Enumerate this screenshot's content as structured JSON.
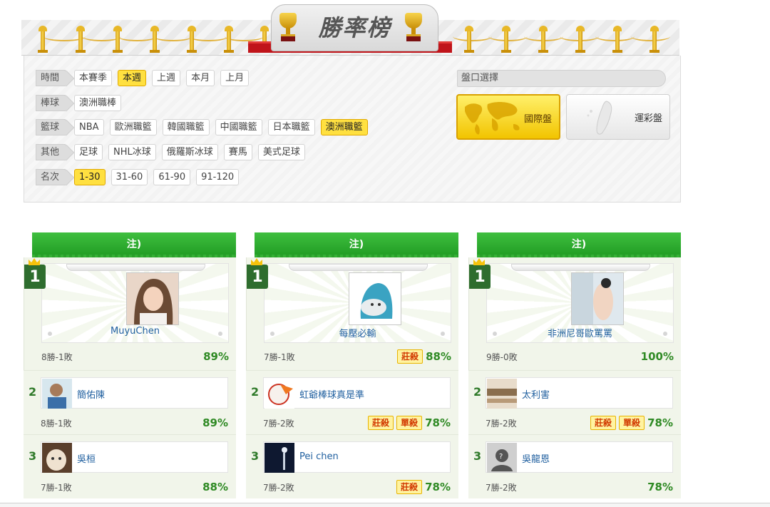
{
  "banner": {
    "title": "勝率榜"
  },
  "filters": {
    "rows": [
      {
        "label": "時間",
        "options": [
          {
            "text": "本賽季",
            "active": false
          },
          {
            "text": "本週",
            "active": true
          },
          {
            "text": "上週",
            "active": false
          },
          {
            "text": "本月",
            "active": false
          },
          {
            "text": "上月",
            "active": false
          }
        ]
      },
      {
        "label": "棒球",
        "options": [
          {
            "text": "澳洲職棒",
            "active": false
          }
        ]
      },
      {
        "label": "籃球",
        "options": [
          {
            "text": "NBA",
            "active": false
          },
          {
            "text": "歐洲職籃",
            "active": false
          },
          {
            "text": "韓國職籃",
            "active": false
          },
          {
            "text": "中國職籃",
            "active": false
          },
          {
            "text": "日本職籃",
            "active": false
          },
          {
            "text": "澳洲職籃",
            "active": true
          }
        ]
      },
      {
        "label": "其他",
        "options": [
          {
            "text": "足球",
            "active": false
          },
          {
            "text": "NHL冰球",
            "active": false
          },
          {
            "text": "俄羅斯冰球",
            "active": false
          },
          {
            "text": "賽馬",
            "active": false
          },
          {
            "text": "美式足球",
            "active": false
          }
        ]
      },
      {
        "label": "名次",
        "options": [
          {
            "text": "1-30",
            "active": true
          },
          {
            "text": "31-60",
            "active": false
          },
          {
            "text": "61-90",
            "active": false
          },
          {
            "text": "91-120",
            "active": false
          }
        ]
      }
    ]
  },
  "market": {
    "header": "盤口選擇",
    "international": "國際盤",
    "lottery": "運彩盤"
  },
  "columns": [
    {
      "header": "注)",
      "first": {
        "rank": "1",
        "name": "MuyuChen",
        "record": "8勝-1敗",
        "pct": "89%",
        "badges": []
      },
      "rows": [
        {
          "rank": "2",
          "name": "簡佑陳",
          "record": "8勝-1敗",
          "pct": "89%",
          "badges": []
        },
        {
          "rank": "3",
          "name": "吳桓",
          "record": "7勝-1敗",
          "pct": "88%",
          "badges": []
        }
      ]
    },
    {
      "header": "注)",
      "first": {
        "rank": "1",
        "name": "每壓必輸",
        "record": "7勝-1敗",
        "pct": "88%",
        "badges": [
          "莊殺"
        ]
      },
      "rows": [
        {
          "rank": "2",
          "name": "虹爺棒球真是準",
          "record": "7勝-2敗",
          "pct": "78%",
          "badges": [
            "莊殺",
            "單殺"
          ]
        },
        {
          "rank": "3",
          "name": "Pei chen",
          "record": "7勝-2敗",
          "pct": "78%",
          "badges": [
            "莊殺"
          ]
        }
      ]
    },
    {
      "header": "注)",
      "first": {
        "rank": "1",
        "name": "非洲尼哥歐罵罵",
        "record": "9勝-0敗",
        "pct": "100%",
        "badges": []
      },
      "rows": [
        {
          "rank": "2",
          "name": "太利害",
          "record": "7勝-2敗",
          "pct": "78%",
          "badges": [
            "莊殺",
            "單殺"
          ]
        },
        {
          "rank": "3",
          "name": "吳龍恩",
          "record": "7勝-2敗",
          "pct": "78%",
          "badges": []
        }
      ]
    }
  ]
}
